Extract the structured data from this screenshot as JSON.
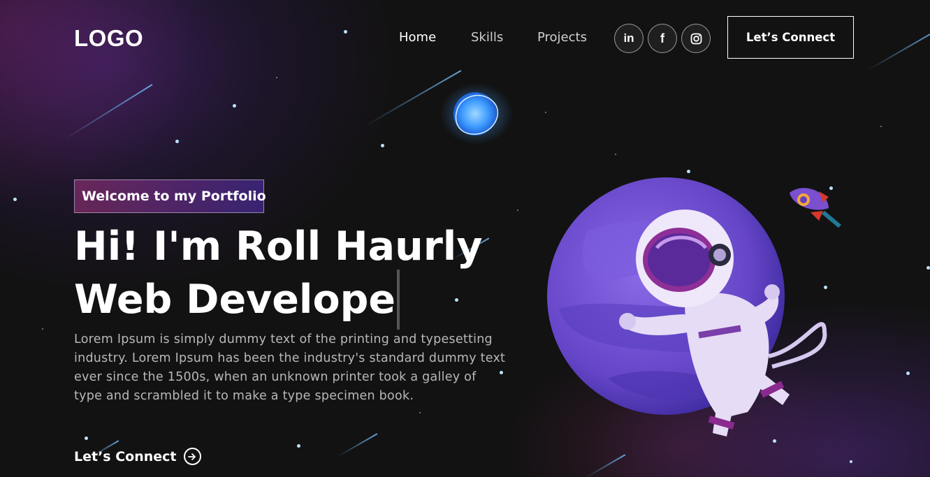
{
  "nav": {
    "logo": "LOGO",
    "links": [
      "Home",
      "Skills",
      "Projects"
    ],
    "social": [
      {
        "name": "linkedin-icon",
        "glyph": "in"
      },
      {
        "name": "facebook-icon",
        "glyph": "f"
      },
      {
        "name": "instagram-icon",
        "glyph": ""
      }
    ],
    "cta_label": "Let’s Connect"
  },
  "hero": {
    "tagline": "Welcome to my Portfolio",
    "headline_line1": "Hi! I'm Roll Haurly",
    "headline_line2": "Web Develope",
    "description": "Lorem Ipsum is simply dummy text of the printing and typesetting industry. Lorem Ipsum has been the industry's standard dummy text ever since the 1500s, when an unknown printer took a galley of type and scrambled it to make a type specimen book.",
    "connect_label": "Let’s Connect"
  },
  "colors": {
    "background": "#121212",
    "tagline_gradient_start": "#aa367c",
    "tagline_gradient_end": "#4a2fbd",
    "planet": "#6c4fd0",
    "star": "#b9e4ff"
  }
}
